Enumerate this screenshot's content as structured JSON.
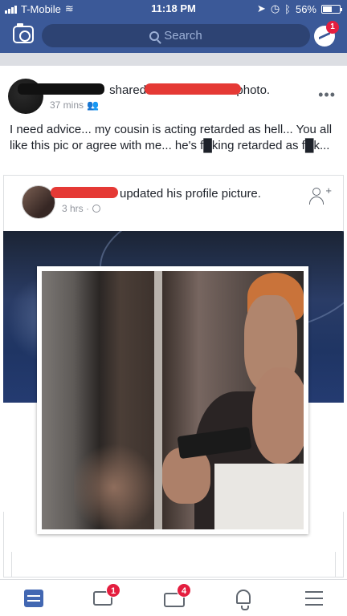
{
  "status": {
    "carrier": "T-Mobile",
    "time": "11:18 PM",
    "battery": "56%",
    "battery_level": 0.56
  },
  "navbar": {
    "search_placeholder": "Search",
    "messenger_badge": "1"
  },
  "post": {
    "action_text": "shared",
    "object_text": "photo.",
    "time": "37 mins",
    "text": "I need advice... my cousin is acting retarded as hell... You all like this pic or agree with me... he's f█king retarded as f█k...",
    "more_label": "•••"
  },
  "shared_post": {
    "action_text": "updated his profile picture.",
    "time": "3 hrs ·"
  },
  "tabbar": {
    "video_badge": "1",
    "marketplace_badge": "4"
  },
  "icons": {
    "camera": "camera-icon",
    "messenger": "messenger-icon",
    "search": "search-icon",
    "add_friend": "add-friend-icon",
    "home": "news-feed-icon",
    "video": "video-icon",
    "marketplace": "marketplace-icon",
    "notifications": "bell-icon",
    "menu": "menu-icon"
  },
  "colors": {
    "brand": "#3b5998",
    "badge": "#e41e3f"
  }
}
